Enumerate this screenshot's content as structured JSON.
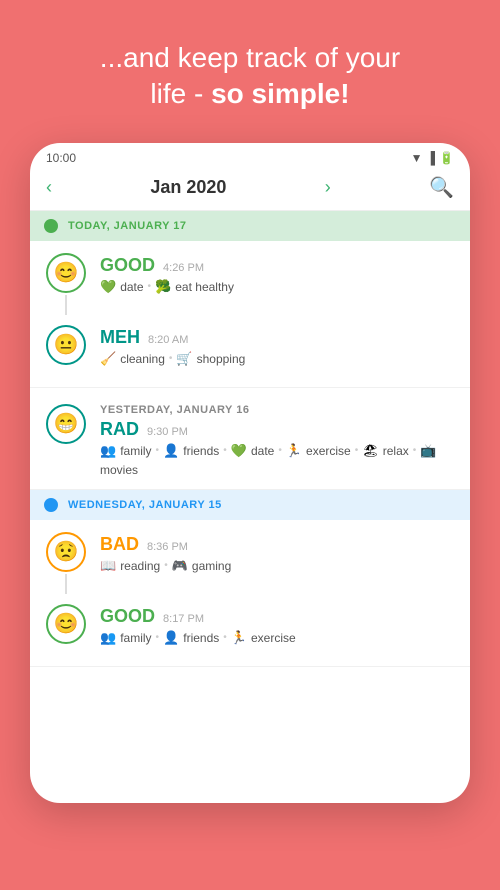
{
  "header": {
    "line1": "...and keep track of your",
    "line2": "life - ",
    "line2_bold": "so simple!"
  },
  "phone": {
    "status_bar": {
      "time": "10:00"
    },
    "nav": {
      "month": "Jan 2020",
      "prev_label": "‹",
      "next_label": "›"
    },
    "days": [
      {
        "id": "today",
        "type": "today",
        "label": "TODAY, JANUARY 17",
        "dot_color": "green",
        "entries": [
          {
            "mood": "GOOD",
            "mood_key": "good",
            "time": "4:26 PM",
            "emoji": "😊",
            "circle_color": "green",
            "tags": [
              {
                "icon": "💚",
                "label": "date"
              },
              {
                "icon": "🥦",
                "label": "eat healthy"
              }
            ]
          },
          {
            "mood": "MEH",
            "mood_key": "meh",
            "time": "8:20 AM",
            "emoji": "😐",
            "circle_color": "teal",
            "tags": [
              {
                "icon": "🧹",
                "label": "cleaning"
              },
              {
                "icon": "🛒",
                "label": "shopping"
              }
            ]
          }
        ]
      },
      {
        "id": "yesterday",
        "type": "yesterday",
        "label": "YESTERDAY, JANUARY 16",
        "dot_color": "none",
        "entries": [
          {
            "mood": "RAD",
            "mood_key": "rad",
            "time": "9:30 PM",
            "emoji": "😁",
            "circle_color": "teal",
            "tags": [
              {
                "icon": "👥",
                "label": "family"
              },
              {
                "icon": "👤",
                "label": "friends"
              },
              {
                "icon": "💚",
                "label": "date"
              },
              {
                "icon": "🏃",
                "label": "exercise"
              },
              {
                "icon": "🏖",
                "label": "relax"
              },
              {
                "icon": "📺",
                "label": "movies"
              }
            ]
          }
        ]
      },
      {
        "id": "wednesday",
        "type": "wednesday",
        "label": "WEDNESDAY, JANUARY 15",
        "dot_color": "blue",
        "entries": [
          {
            "mood": "BAD",
            "mood_key": "bad",
            "time": "8:36 PM",
            "emoji": "😟",
            "circle_color": "orange",
            "tags": [
              {
                "icon": "📖",
                "label": "reading"
              },
              {
                "icon": "🎮",
                "label": "gaming"
              }
            ]
          },
          {
            "mood": "GOOD",
            "mood_key": "good",
            "time": "8:17 PM",
            "emoji": "😊",
            "circle_color": "green",
            "tags": [
              {
                "icon": "👥",
                "label": "family"
              },
              {
                "icon": "👤",
                "label": "friends"
              },
              {
                "icon": "🏃",
                "label": "exercise"
              }
            ]
          }
        ]
      }
    ]
  }
}
